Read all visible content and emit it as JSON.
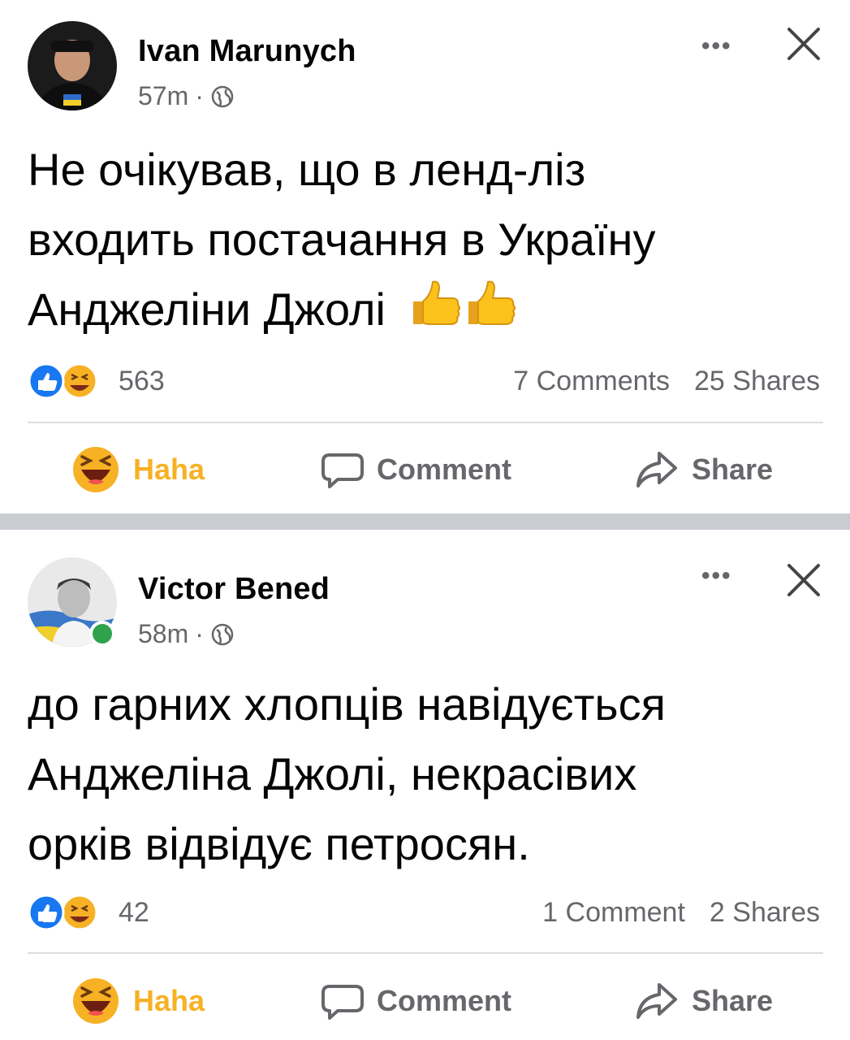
{
  "posts": [
    {
      "author": "Ivan Marunych",
      "time": "57m",
      "separator": "·",
      "text_lines": [
        "Не очікував, що в ленд-ліз",
        "входить постачання в Україну",
        "Анджеліни Джолі"
      ],
      "text_emoji": "thumbs-up-icon x2",
      "reactions_count": "563",
      "comments": "7 Comments",
      "shares": "25 Shares",
      "actions": {
        "haha": "Haha",
        "comment": "Comment",
        "share": "Share"
      }
    },
    {
      "author": "Victor Bened",
      "time": "58m",
      "separator": "·",
      "text_lines": [
        "до гарних хлопців навідується",
        "Анджеліна Джолі, некрасівих",
        "орків відвідує петросян."
      ],
      "reactions_count": "42",
      "comments": "1 Comment",
      "shares": "2 Shares",
      "actions": {
        "haha": "Haha",
        "comment": "Comment",
        "share": "Share"
      }
    }
  ],
  "colors": {
    "haha_yellow": "#f7b125",
    "like_blue": "#1877f2",
    "secondary_text": "#65676b",
    "online_green": "#31a24c",
    "separator_gray": "#c9ccd1"
  }
}
